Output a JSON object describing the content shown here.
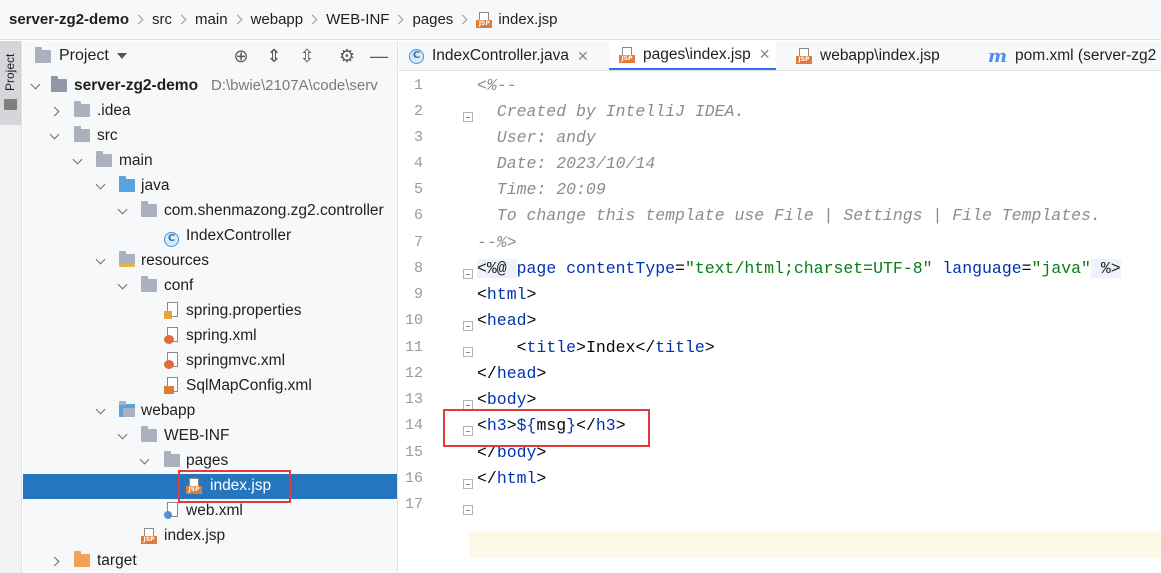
{
  "breadcrumb": [
    "server-zg2-demo",
    "src",
    "main",
    "webapp",
    "WEB-INF",
    "pages",
    "index.jsp"
  ],
  "toolstrip": {
    "project_label": "Project"
  },
  "project_panel": {
    "title": "Project",
    "root_path": "D:\\bwie\\2107A\\code\\serv",
    "tree": [
      {
        "label": "server-zg2-demo",
        "icon": "module-folder-icon"
      },
      {
        "label": ".idea",
        "icon": "folder-icon"
      },
      {
        "label": "src",
        "icon": "folder-icon"
      },
      {
        "label": "main",
        "icon": "folder-icon"
      },
      {
        "label": "java",
        "icon": "source-folder-icon"
      },
      {
        "label": "com.shenmazong.zg2.controller",
        "icon": "package-icon"
      },
      {
        "label": "IndexController",
        "icon": "class-icon"
      },
      {
        "label": "resources",
        "icon": "resources-folder-icon"
      },
      {
        "label": "conf",
        "icon": "folder-icon"
      },
      {
        "label": "spring.properties",
        "icon": "properties-file-icon"
      },
      {
        "label": "spring.xml",
        "icon": "spring-xml-icon"
      },
      {
        "label": "springmvc.xml",
        "icon": "spring-xml-icon"
      },
      {
        "label": "SqlMapConfig.xml",
        "icon": "xml-file-icon"
      },
      {
        "label": "webapp",
        "icon": "web-folder-icon"
      },
      {
        "label": "WEB-INF",
        "icon": "folder-icon"
      },
      {
        "label": "pages",
        "icon": "folder-icon"
      },
      {
        "label": "index.jsp",
        "icon": "jsp-file-icon"
      },
      {
        "label": "web.xml",
        "icon": "web-xml-icon"
      },
      {
        "label": "index.jsp",
        "icon": "jsp-file-icon"
      },
      {
        "label": "target",
        "icon": "excluded-folder-icon"
      }
    ]
  },
  "tabs": [
    {
      "label": "IndexController.java",
      "icon": "class-icon"
    },
    {
      "label": "pages\\index.jsp",
      "icon": "jsp-file-icon"
    },
    {
      "label": "webapp\\index.jsp",
      "icon": "jsp-file-icon"
    },
    {
      "label": "pom.xml (server-zg2",
      "icon": "maven-icon"
    }
  ],
  "editor": {
    "line_numbers": [
      "1",
      "2",
      "3",
      "4",
      "5",
      "6",
      "7",
      "8",
      "9",
      "10",
      "11",
      "12",
      "13",
      "14",
      "15",
      "16",
      "17"
    ],
    "lines": {
      "l1": "<%--",
      "l2": "  Created by IntelliJ IDEA.",
      "l3": "  User: andy",
      "l4": "  Date: 2023/10/14",
      "l5": "  Time: 20:09",
      "l6": "  To change this template use File | Settings | File Templates.",
      "l7": "--%>",
      "l8": {
        "open": "<%@ ",
        "kw1": "page",
        "sp1": " ",
        "attr1": "contentType",
        "eq1": "=",
        "val1": "\"text/html;charset=UTF-8\"",
        "sp2": " ",
        "attr2": "language",
        "eq2": "=",
        "val2": "\"java\"",
        "close": " %>"
      },
      "l9": {
        "lt": "<",
        "tag": "html",
        "gt": ">"
      },
      "l10": {
        "lt": "<",
        "tag": "head",
        "gt": ">"
      },
      "l11": {
        "indent": "    ",
        "lt": "<",
        "tag": "title",
        "gt": ">",
        "text": "Index",
        "lt2": "</",
        "tag2": "title",
        "gt2": ">"
      },
      "l12": {
        "lt": "</",
        "tag": "head",
        "gt": ">"
      },
      "l13": {
        "lt": "<",
        "tag": "body",
        "gt": ">"
      },
      "l14": {
        "lt": "<",
        "tag": "h3",
        "gt": ">",
        "expr_open": "${",
        "expr": "msg",
        "expr_close": "}",
        "lt2": "</",
        "tag2": "h3",
        "gt2": ">"
      },
      "l15": {
        "lt": "</",
        "tag": "body",
        "gt": ">"
      },
      "l16": {
        "lt": "</",
        "tag": "html",
        "gt": ">"
      }
    }
  },
  "colors": {
    "accent": "#3574f0",
    "selection": "#2675bf",
    "highlight_box": "#e23b3b",
    "tag": "#0033b3",
    "string": "#067d17",
    "comment": "#8c8c8c"
  }
}
